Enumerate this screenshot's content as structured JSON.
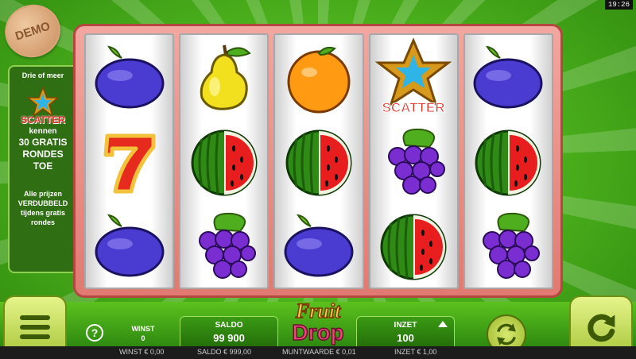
{
  "clock": "19:26",
  "demo_badge": "DEMO",
  "info_panel": {
    "heading": "Drie of meer",
    "scatter_label": "SCATTER",
    "line1": "kennen",
    "line2": "30 GRATIS",
    "line3": "RONDES",
    "line4": "TOE",
    "note1": "Alle prijzen",
    "note2": "VERDUBBELD",
    "note3": "tijdens gratis",
    "note4": "rondes"
  },
  "reels": [
    [
      "plum",
      "seven",
      "plum"
    ],
    [
      "pear",
      "watermelon",
      "grapes"
    ],
    [
      "orange",
      "watermelon",
      "plum"
    ],
    [
      "scatter",
      "grapes",
      "watermelon"
    ],
    [
      "plum",
      "watermelon",
      "grapes"
    ]
  ],
  "scatter_symbol_label": "SCATTER",
  "controls": {
    "help": "?",
    "winst_label": "WINST",
    "winst_value": "0",
    "saldo_label": "SALDO",
    "saldo_value": "99 900",
    "inzet_label": "INZET",
    "inzet_value": "100",
    "logo_top": "Fruit",
    "logo_bottom": "Drop"
  },
  "footer": {
    "winst": "WINST € 0,00",
    "saldo": "SALDO € 999,00",
    "muntwaarde": "MUNTWAARDE € 0,01",
    "inzet": "INZET € 1,00"
  },
  "colors": {
    "background_green": "#4fb51e",
    "frame_pink": "#e07a72",
    "button_lime": "#d7e871"
  }
}
